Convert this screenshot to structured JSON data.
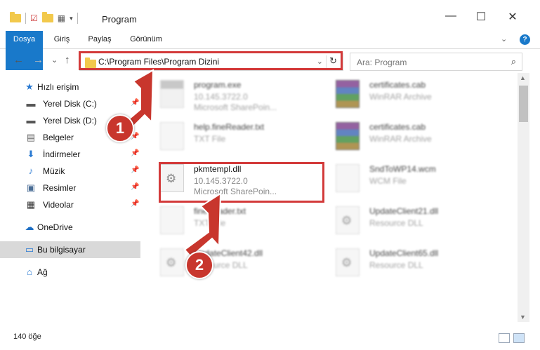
{
  "window": {
    "title": "Program",
    "controls": {
      "minimize": "—",
      "maximize": "☐",
      "close": "✕"
    }
  },
  "ribbon": {
    "tabs": [
      "Dosya",
      "Giriş",
      "Paylaş",
      "Görünüm"
    ],
    "collapse_icon": "chevron-down-icon",
    "help_label": "?"
  },
  "nav": {
    "back": "←",
    "forward": "→",
    "recent": "⌄",
    "up": "↑",
    "address_path": "C:\\Program Files\\Program Dizini",
    "dropdown": "⌄",
    "refresh": "↻",
    "search_placeholder": "Ara: Program",
    "search_icon": "⌕"
  },
  "sidebar": {
    "items": [
      {
        "label": "Hızlı erişim",
        "icon": "★",
        "pinned": false
      },
      {
        "label": "Yerel Disk (C:)",
        "icon": "▬",
        "pinned": true
      },
      {
        "label": "Yerel Disk (D:)",
        "icon": "▬",
        "pinned": true
      },
      {
        "label": "Belgeler",
        "icon": "▤",
        "pinned": true
      },
      {
        "label": "İndirmeler",
        "icon": "⬇",
        "pinned": true
      },
      {
        "label": "Müzik",
        "icon": "♪",
        "pinned": true
      },
      {
        "label": "Resimler",
        "icon": "▣",
        "pinned": true
      },
      {
        "label": "Videolar",
        "icon": "▦",
        "pinned": true
      },
      {
        "label": "OneDrive",
        "icon": "☁",
        "pinned": false
      },
      {
        "label": "Bu bilgisayar",
        "icon": "▭",
        "pinned": false,
        "selected": true
      },
      {
        "label": "Ağ",
        "icon": "⌂",
        "pinned": false
      }
    ]
  },
  "files": [
    {
      "name": "program.exe",
      "line2": "10.145.3722.0",
      "line3": "Microsoft SharePoin...",
      "type": "exe"
    },
    {
      "name": "certificates.cab",
      "line2": "WinRAR Archive",
      "line3": "",
      "type": "zip"
    },
    {
      "name": "help.fineReader.txt",
      "line2": "TXT File",
      "line3": "",
      "type": "txt"
    },
    {
      "name": "certificates.cab",
      "line2": "WinRAR Archive",
      "line3": "",
      "type": "zip"
    },
    {
      "name": "pkmtempl.dll",
      "line2": "10.145.3722.0",
      "line3": "Microsoft SharePoin...",
      "type": "dll"
    },
    {
      "name": "SndToWP14.wcm",
      "line2": "WCM File",
      "line3": "",
      "type": "txt"
    },
    {
      "name": "fineReader.txt",
      "line2": "TXT File",
      "line3": "",
      "type": "txt"
    },
    {
      "name": "UpdateClient21.dll",
      "line2": "Resource DLL",
      "line3": "",
      "type": "dll"
    },
    {
      "name": "UpdateClient42.dll",
      "line2": "Resource DLL",
      "line3": "",
      "type": "dll"
    },
    {
      "name": "UpdateClient65.dll",
      "line2": "Resource DLL",
      "line3": "",
      "type": "dll"
    }
  ],
  "status": {
    "count": "140 öğe"
  },
  "callouts": {
    "step1": "1",
    "step2": "2",
    "color": "#c8362d",
    "highlight": "#d33a3a"
  }
}
